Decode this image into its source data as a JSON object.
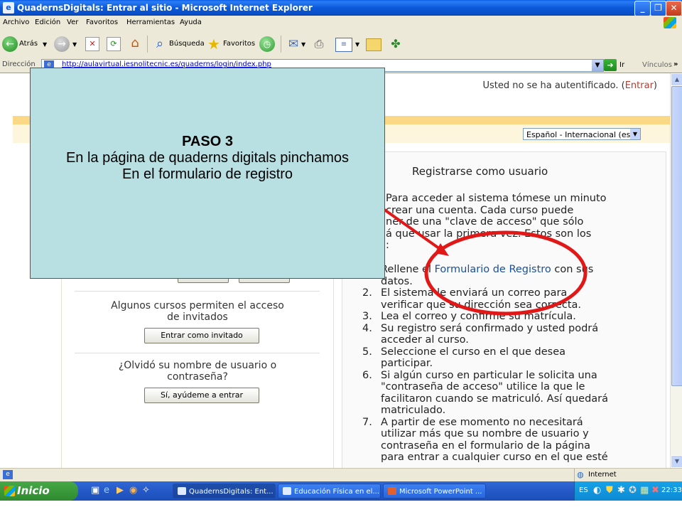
{
  "window": {
    "title": "QuadernsDigitals: Entrar al sitio - Microsoft Internet Explorer"
  },
  "menu": [
    "Archivo",
    "Edición",
    "Ver",
    "Favoritos",
    "Herramientas",
    "Ayuda"
  ],
  "toolbar": {
    "back": "Atrás",
    "search": "Búsqueda",
    "favorites": "Favoritos"
  },
  "address": {
    "label": "Dirección",
    "url": "http://aulavirtual.iesnolitecnic.es/quaderns/login/index.php",
    "go": "Ir",
    "links": "Vínculos"
  },
  "page": {
    "auth_text": "Usted no se ha autentificado. (",
    "auth_link": "Entrar",
    "auth_close": ")",
    "language": "Español - Internacional (es)",
    "guest_text": [
      "Algunos cursos permiten el acceso",
      "de invitados"
    ],
    "guest_button": "Entrar como invitado",
    "forgot_text": [
      "¿Olvidó su nombre de usuario o",
      "contraseña?"
    ],
    "forgot_button": "Sí, ayúdeme a entrar",
    "register_title": "Registrarse como usuario",
    "intro_lines": [
      "Para acceder al sistema tómese un minuto",
      "crear una cuenta. Cada curso puede",
      "ner de una \"clave de acceso\" que sólo",
      "á que usar la primera vez. Estos son los",
      ":"
    ],
    "step1_a": "Rellene el ",
    "step1_link": "Formulario de Registro",
    "step1_b": " con sus",
    "step1_c": "datos.",
    "steps": [
      {
        "n": "2.",
        "lines": [
          "El sistema le enviará un correo para",
          "verificar que su dirección sea correcta."
        ]
      },
      {
        "n": "3.",
        "lines": [
          "Lea el correo y confirme su matrícula."
        ]
      },
      {
        "n": "4.",
        "lines": [
          "Su registro será confirmado y usted podrá",
          "acceder al curso."
        ]
      },
      {
        "n": "5.",
        "lines": [
          "Seleccione el curso en el que desea",
          "participar."
        ]
      },
      {
        "n": "6.",
        "lines": [
          "Si algún curso en particular le solicita una",
          "\"contraseña de acceso\" utilice la que le",
          "facilitaron cuando se matriculó. Así quedará",
          "matriculado."
        ]
      },
      {
        "n": "7.",
        "lines": [
          "A partir de ese momento no necesitará",
          "utilizar más que su nombre de usuario y",
          "contraseña en el formulario de la página",
          "para entrar a cualquier curso en el que esté"
        ]
      }
    ]
  },
  "overlay": {
    "title": "PASO 3",
    "line1": "En la página de quaderns digitals pinchamos",
    "line2": "En el formulario de registro"
  },
  "status": {
    "zone": "Internet"
  },
  "taskbar": {
    "start": "Inicio",
    "tasks": [
      "QuadernsDigitals: Ent...",
      "Educación Física en el...",
      "Microsoft PowerPoint ..."
    ],
    "lang": "ES",
    "clock": "22:33"
  },
  "colors": {
    "accent": "#1a4f9c",
    "highlight": "#e01818",
    "overlay": "#b8dfe1"
  }
}
